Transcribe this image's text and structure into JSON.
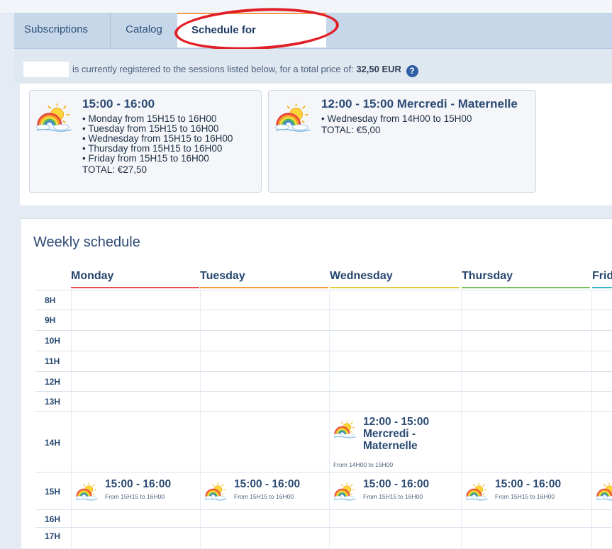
{
  "tabs": [
    {
      "label": "Subscriptions"
    },
    {
      "label": "Catalog"
    },
    {
      "label": "Schedule for"
    }
  ],
  "info": {
    "text": "is currently registered to the sessions listed below, for a total price of:",
    "price": "32,50 EUR",
    "help_icon": "?"
  },
  "cards": [
    {
      "title": "15:00 - 16:00",
      "items": [
        "• Monday from 15H15 to 16H00",
        "• Tuesday from 15H15 to 16H00",
        "• Wednesday from 15H15 to 16H00",
        "• Thursday from 15H15 to 16H00",
        "• Friday from 15H15 to 16H00"
      ],
      "total": "TOTAL: €27,50",
      "icon": "rainbow-sun-icon"
    },
    {
      "title": "12:00 - 15:00 Mercredi - Maternelle",
      "items": [
        "• Wednesday from 14H00 to 15H00"
      ],
      "total": "TOTAL: €5,00",
      "icon": "rainbow-sun-icon"
    }
  ],
  "weekly": {
    "title": "Weekly schedule",
    "days": [
      "Monday",
      "Tuesday",
      "Wednesday",
      "Thursday",
      "Friday"
    ],
    "day_colors": [
      "#e8504f",
      "#f39a3a",
      "#e9c83c",
      "#79c35a",
      "#39b5c8"
    ],
    "hours": [
      "8H",
      "9H",
      "10H",
      "11H",
      "12H",
      "13H",
      "14H",
      "15H",
      "16H",
      "17H"
    ],
    "wed_event": {
      "line1": "12:00 - 15:00",
      "line2": "Mercredi -",
      "line3": "Maternelle",
      "sub": "From 14H00 to 15H00"
    },
    "slot_events": [
      {
        "time": "15:00 - 16:00",
        "sub": "From 15H15 to 16H00"
      },
      {
        "time": "15:00 - 16:00",
        "sub": "From 15H15 to 16H00"
      },
      {
        "time": "15:00 - 16:00",
        "sub": "From 15H15 to 16H00"
      },
      {
        "time": "15:00 - 16:00",
        "sub": "From 15H15 to 16H00"
      }
    ]
  }
}
